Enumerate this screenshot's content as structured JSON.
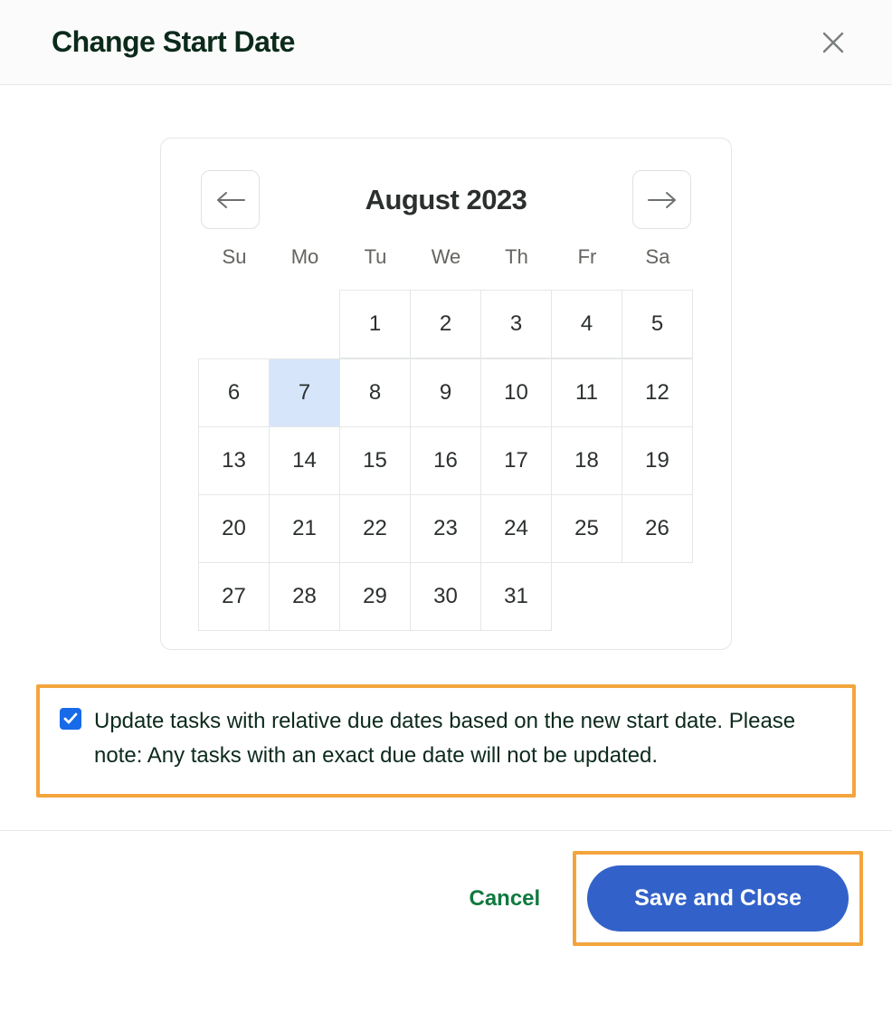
{
  "header": {
    "title": "Change Start Date"
  },
  "calendar": {
    "month_label": "August 2023",
    "dow": [
      "Su",
      "Mo",
      "Tu",
      "We",
      "Th",
      "Fr",
      "Sa"
    ],
    "lead_blanks": 2,
    "days_in_month": 31,
    "selected_day": 7
  },
  "checkbox": {
    "checked": true,
    "label": "Update tasks with relative due dates based on the new start date. Please note: Any tasks with an exact due date will not be updated."
  },
  "footer": {
    "cancel_label": "Cancel",
    "primary_label": "Save and Close"
  },
  "colors": {
    "highlight_border": "#f3a53d",
    "primary_button": "#3262c9",
    "checkbox_bg": "#176be8",
    "selected_day_bg": "#d7e5fb"
  }
}
